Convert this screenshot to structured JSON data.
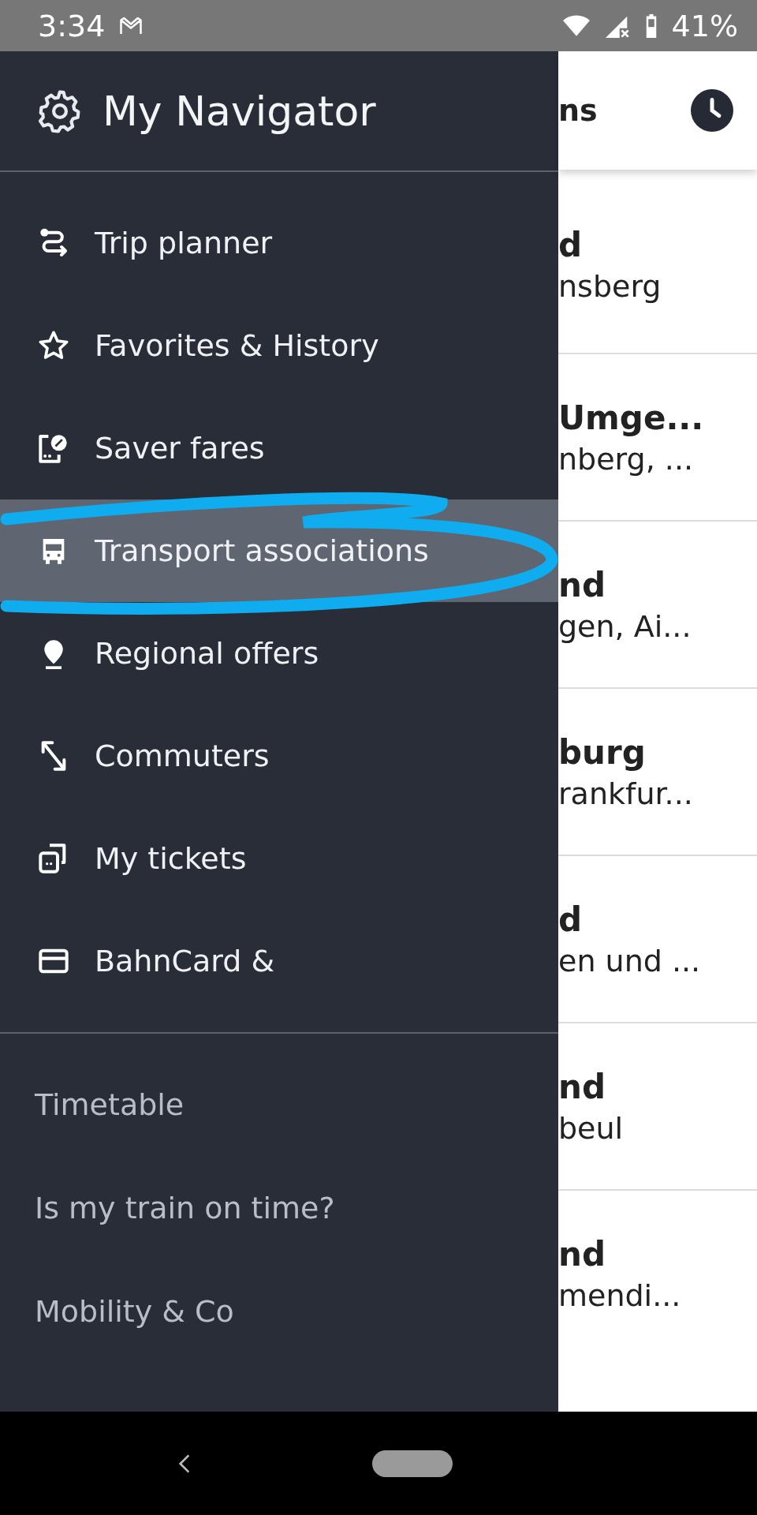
{
  "status_bar": {
    "time": "3:34",
    "battery": "41%"
  },
  "drawer": {
    "title": "My Navigator",
    "items": [
      {
        "label": "Trip planner",
        "selected": false
      },
      {
        "label": "Favorites & History",
        "selected": false
      },
      {
        "label": "Saver fares",
        "selected": false
      },
      {
        "label": "Transport associations",
        "selected": true
      },
      {
        "label": "Regional offers",
        "selected": false
      },
      {
        "label": "Commuters",
        "selected": false
      },
      {
        "label": "My tickets",
        "selected": false
      },
      {
        "label": "BahnCard &",
        "selected": false
      }
    ],
    "links": [
      "Timetable",
      "Is my train on time?",
      "Mobility & Co"
    ]
  },
  "app_bar": {
    "title": "ns"
  },
  "list": [
    {
      "title": "d",
      "subtitle": "nsberg"
    },
    {
      "title": "Umge...",
      "subtitle": "nberg, ..."
    },
    {
      "title": "nd",
      "subtitle": "gen, Ai..."
    },
    {
      "title": "burg",
      "subtitle": "rankfur..."
    },
    {
      "title": "d",
      "subtitle": "en und ..."
    },
    {
      "title": "nd",
      "subtitle": "beul"
    },
    {
      "title": "nd",
      "subtitle": "mendi..."
    }
  ]
}
